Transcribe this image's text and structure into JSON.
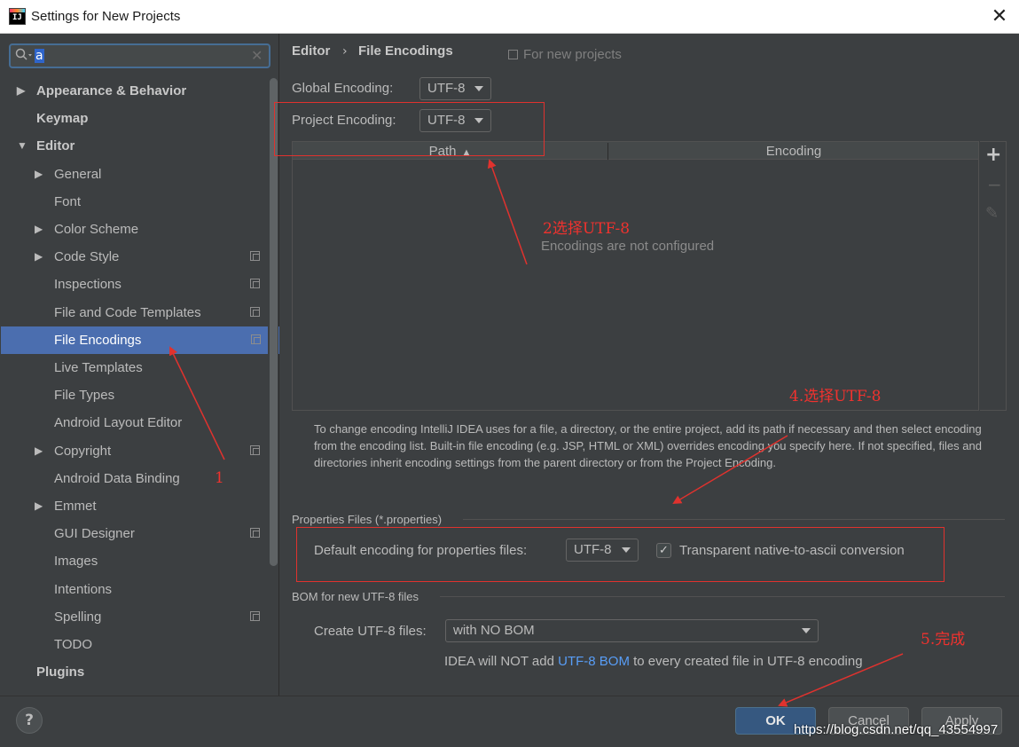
{
  "window": {
    "title": "Settings for New Projects",
    "close_glyph": "✕",
    "app_icon_text": "IJ"
  },
  "search": {
    "value": "a",
    "icon": "search-icon",
    "clear_glyph": "✕"
  },
  "tree": [
    {
      "label": "Appearance & Behavior",
      "level": 0,
      "bold": true,
      "arrow": "▶",
      "badge": false
    },
    {
      "label": "Keymap",
      "level": 0,
      "bold": true,
      "arrow": "",
      "badge": false
    },
    {
      "label": "Editor",
      "level": 0,
      "bold": true,
      "arrow": "▼",
      "badge": false
    },
    {
      "label": "General",
      "level": 1,
      "bold": false,
      "arrow": "▶",
      "badge": false
    },
    {
      "label": "Font",
      "level": 1,
      "bold": false,
      "arrow": "",
      "badge": false
    },
    {
      "label": "Color Scheme",
      "level": 1,
      "bold": false,
      "arrow": "▶",
      "badge": false
    },
    {
      "label": "Code Style",
      "level": 1,
      "bold": false,
      "arrow": "▶",
      "badge": true
    },
    {
      "label": "Inspections",
      "level": 1,
      "bold": false,
      "arrow": "",
      "badge": true
    },
    {
      "label": "File and Code Templates",
      "level": 1,
      "bold": false,
      "arrow": "",
      "badge": true
    },
    {
      "label": "File Encodings",
      "level": 1,
      "bold": false,
      "arrow": "",
      "badge": true,
      "selected": true
    },
    {
      "label": "Live Templates",
      "level": 1,
      "bold": false,
      "arrow": "",
      "badge": false
    },
    {
      "label": "File Types",
      "level": 1,
      "bold": false,
      "arrow": "",
      "badge": false
    },
    {
      "label": "Android Layout Editor",
      "level": 1,
      "bold": false,
      "arrow": "",
      "badge": false
    },
    {
      "label": "Copyright",
      "level": 1,
      "bold": false,
      "arrow": "▶",
      "badge": true
    },
    {
      "label": "Android Data Binding",
      "level": 1,
      "bold": false,
      "arrow": "",
      "badge": false
    },
    {
      "label": "Emmet",
      "level": 1,
      "bold": false,
      "arrow": "▶",
      "badge": false
    },
    {
      "label": "GUI Designer",
      "level": 1,
      "bold": false,
      "arrow": "",
      "badge": true
    },
    {
      "label": "Images",
      "level": 1,
      "bold": false,
      "arrow": "",
      "badge": false
    },
    {
      "label": "Intentions",
      "level": 1,
      "bold": false,
      "arrow": "",
      "badge": false
    },
    {
      "label": "Spelling",
      "level": 1,
      "bold": false,
      "arrow": "",
      "badge": true
    },
    {
      "label": "TODO",
      "level": 1,
      "bold": false,
      "arrow": "",
      "badge": false
    },
    {
      "label": "Plugins",
      "level": 0,
      "bold": true,
      "arrow": "",
      "badge": false
    }
  ],
  "breadcrumb": {
    "parent": "Editor",
    "separator": "›",
    "current": "File Encodings",
    "scope_label": "For new projects"
  },
  "global_encoding": {
    "label": "Global Encoding:",
    "value": "UTF-8"
  },
  "project_encoding": {
    "label": "Project Encoding:",
    "value": "UTF-8"
  },
  "table": {
    "columns": [
      "Path",
      "Encoding"
    ],
    "sort_glyph": "▲",
    "empty_text": "Encodings are not configured",
    "toolbar": {
      "add": "+",
      "remove": "−",
      "edit": "✎"
    }
  },
  "help_text": "To change encoding IntelliJ IDEA uses for a file, a directory, or the entire project, add its path if necessary and then select encoding from the encoding list. Built-in file encoding (e.g. JSP, HTML or XML) overrides encoding you specify here. If not specified, files and directories inherit encoding settings from the parent directory or from the Project Encoding.",
  "properties": {
    "section_title": "Properties Files (*.properties)",
    "default_label": "Default encoding for properties files:",
    "default_value": "UTF-8",
    "native_ascii_checked": true,
    "native_ascii_label": "Transparent native-to-ascii conversion",
    "check_glyph": "✓"
  },
  "bom": {
    "section_title": "BOM for new UTF-8 files",
    "create_label": "Create UTF-8 files:",
    "create_value": "with NO BOM",
    "note_prefix": "IDEA will NOT add ",
    "note_link": "UTF-8 BOM",
    "note_suffix": " to every created file in UTF-8 encoding"
  },
  "buttons": {
    "help": "?",
    "ok": "OK",
    "cancel": "Cancel",
    "apply": "Apply"
  },
  "annotations": {
    "step1": "1",
    "step2": "2选择UTF-8",
    "step4": "4.选择UTF-8",
    "step5": "5.完成"
  },
  "watermark": "https://blog.csdn.net/qq_43554997",
  "colors": {
    "background": "#3c3f41",
    "selection": "#4b6eaf",
    "accent_button": "#365880",
    "annotation_red": "#e0322e",
    "link": "#589df6"
  }
}
